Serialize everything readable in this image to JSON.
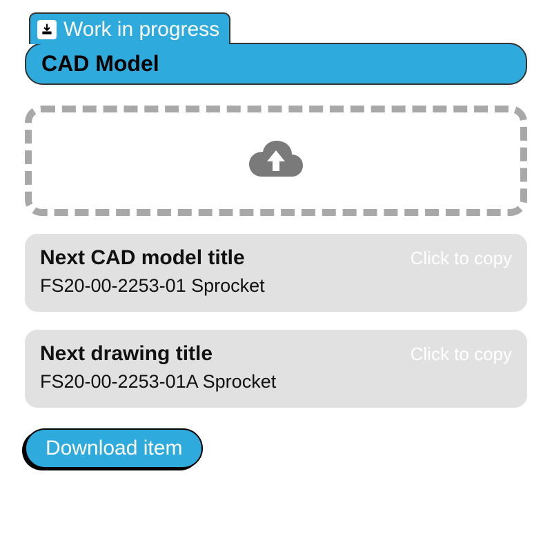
{
  "colors": {
    "accent": "#2eaadc",
    "card_bg": "#e1e1e1",
    "dashed": "#a8a8a8"
  },
  "tab": {
    "label": "Work in progress",
    "icon": "download-box-icon"
  },
  "header": {
    "title": "CAD Model"
  },
  "dropzone": {
    "icon": "cloud-upload-icon"
  },
  "cards": [
    {
      "title": "Next CAD model title",
      "value": "FS20-00-2253-01 Sprocket",
      "action": "Click to copy"
    },
    {
      "title": "Next drawing title",
      "value": "FS20-00-2253-01A Sprocket",
      "action": "Click to copy"
    }
  ],
  "download": {
    "label": "Download item"
  }
}
